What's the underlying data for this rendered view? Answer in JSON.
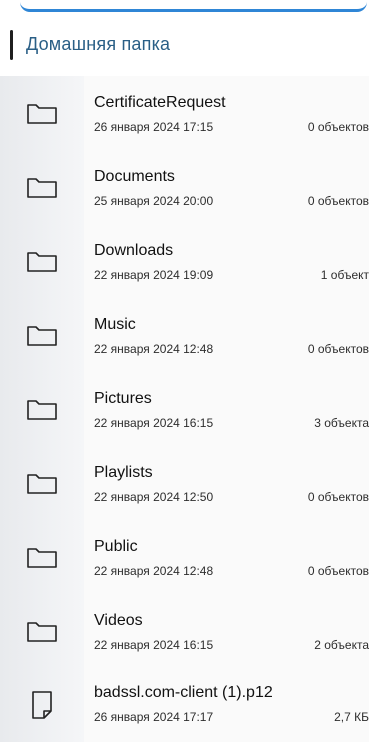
{
  "header": {
    "title": "Домашняя папка"
  },
  "items": [
    {
      "type": "folder",
      "name": "CertificateRequest",
      "date": "26 января 2024 17:15",
      "count": "0 объектов"
    },
    {
      "type": "folder",
      "name": "Documents",
      "date": "25 января 2024 20:00",
      "count": "0 объектов"
    },
    {
      "type": "folder",
      "name": "Downloads",
      "date": "22 января 2024 19:09",
      "count": "1 объект"
    },
    {
      "type": "folder",
      "name": "Music",
      "date": "22 января 2024 12:48",
      "count": "0 объектов"
    },
    {
      "type": "folder",
      "name": "Pictures",
      "date": "22 января 2024 16:15",
      "count": "3 объекта"
    },
    {
      "type": "folder",
      "name": "Playlists",
      "date": "22 января 2024 12:50",
      "count": "0 объектов"
    },
    {
      "type": "folder",
      "name": "Public",
      "date": "22 января 2024 12:48",
      "count": "0 объектов"
    },
    {
      "type": "folder",
      "name": "Videos",
      "date": "22 января 2024 16:15",
      "count": "2 объекта"
    },
    {
      "type": "file",
      "name": "badssl.com-client (1).p12",
      "date": "26 января 2024 17:17",
      "count": "2,7 КБ"
    }
  ],
  "icons": {
    "folder": "folder-icon",
    "file": "file-icon"
  },
  "colors": {
    "accent": "#2f86d6",
    "title": "#2a5f86",
    "icon_bg": "#f1f2f4"
  }
}
